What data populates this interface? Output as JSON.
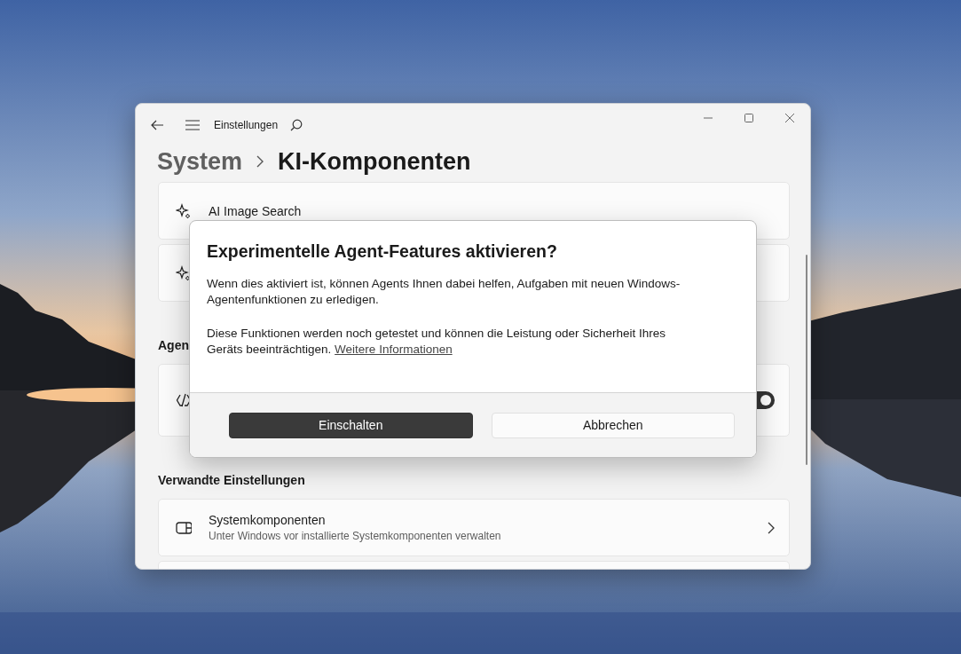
{
  "window": {
    "title": "Einstellungen"
  },
  "breadcrumb": [
    {
      "label": "System",
      "current": false
    },
    {
      "label": "KI-Komponenten",
      "current": true
    }
  ],
  "content": [
    {
      "kind": "feature",
      "label": "AI Image Search"
    },
    {
      "kind": "feature"
    },
    {
      "kind": "heading",
      "text": "Agen"
    },
    {
      "kind": "toggle",
      "on": true
    },
    {
      "kind": "heading",
      "text": "Verwandte Einstellungen"
    },
    {
      "kind": "link",
      "title": "Systemkomponenten",
      "description": "Unter Windows vor installierte Systemkomponenten verwalten"
    },
    {
      "kind": "blank"
    }
  ],
  "dialog": {
    "title": "Experimentelle Agent-Features aktivieren?",
    "paragraphs": [
      {
        "text": "Wenn dies aktiviert ist, können Agents Ihnen dabei helfen, Aufgaben mit neuen Windows-Agentenfunktionen zu erledigen."
      },
      {
        "text": "Diese Funktionen werden noch getestet und können die Leistung oder Sicherheit Ihres Geräts beeinträchtigen.",
        "link": "Weitere Informationen"
      }
    ],
    "buttons": [
      {
        "label": "Einschalten",
        "kind": "primary"
      },
      {
        "label": "Abbrechen",
        "kind": "secondary"
      }
    ]
  }
}
